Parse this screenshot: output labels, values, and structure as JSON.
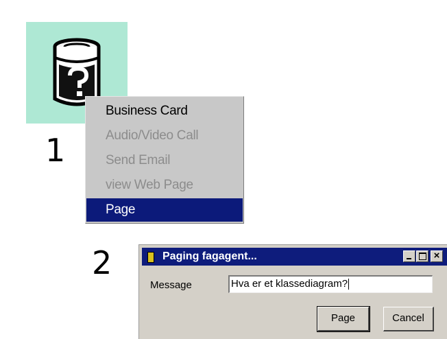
{
  "steps": {
    "first": "1",
    "second": "2"
  },
  "context_menu": {
    "items": [
      {
        "label": "Business Card",
        "state": "enabled"
      },
      {
        "label": "Audio/Video Call",
        "state": "disabled"
      },
      {
        "label": "Send Email",
        "state": "disabled"
      },
      {
        "label": "view Web Page",
        "state": "disabled"
      },
      {
        "label": "Page",
        "state": "selected"
      }
    ]
  },
  "dialog": {
    "title": "Paging fagagent...",
    "message_label": "Message",
    "message_value": "Hva er et klassediagram?",
    "page_button": "Page",
    "cancel_button": "Cancel"
  },
  "colors": {
    "icon_tile": "#aee8d4",
    "menu_background": "#c8c8c8",
    "menu_selection": "#0c1a7a",
    "titlebar": "#0e1c7c",
    "dialog_face": "#d4d0c8"
  }
}
